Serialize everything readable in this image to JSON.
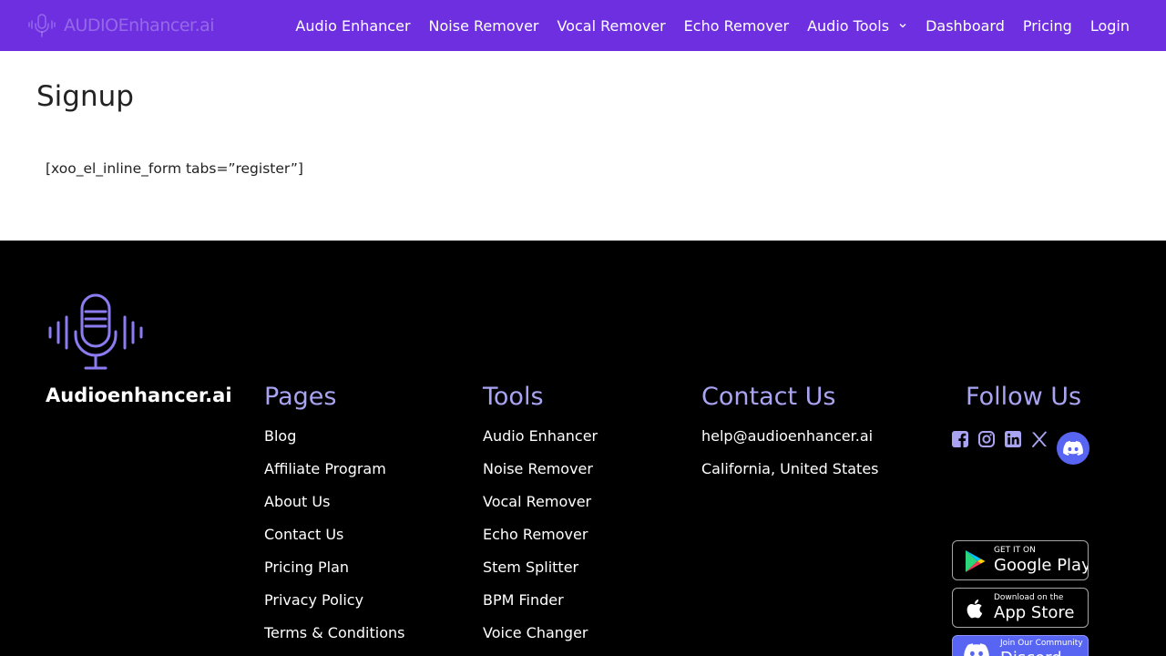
{
  "header": {
    "logo_text": "AUDIOEnhancer.ai",
    "nav": [
      {
        "label": "Audio Enhancer"
      },
      {
        "label": "Noise Remover"
      },
      {
        "label": "Vocal Remover"
      },
      {
        "label": "Echo Remover"
      },
      {
        "label": "Audio Tools",
        "icon": "chevron-down-icon"
      },
      {
        "label": "Dashboard"
      },
      {
        "label": "Pricing"
      },
      {
        "label": "Login"
      }
    ]
  },
  "main": {
    "title": "Signup",
    "shortcode": "[xoo_el_inline_form tabs=”register”]"
  },
  "footer": {
    "brand": "Audioenhancer.ai",
    "pages": {
      "title": "Pages",
      "links": [
        "Blog",
        "Affiliate Program",
        "About Us",
        "Contact Us",
        "Pricing Plan",
        "Privacy Policy",
        "Terms & Conditions"
      ]
    },
    "tools": {
      "title": "Tools",
      "links": [
        "Audio Enhancer",
        "Noise Remover",
        "Vocal Remover",
        "Echo Remover",
        "Stem Splitter",
        "BPM Finder",
        "Voice Changer"
      ]
    },
    "contact": {
      "title": "Contact Us",
      "email": "help@audioenhancer.ai",
      "location": "California, United States"
    },
    "follow": {
      "title": "Follow Us",
      "icons": [
        "facebook-icon",
        "instagram-icon",
        "linkedin-icon",
        "x-icon",
        "discord-icon"
      ]
    },
    "badges": {
      "google_play": {
        "small": "GET IT ON",
        "big": "Google Play"
      },
      "app_store": {
        "small": "Download on the",
        "big": "App Store"
      },
      "discord": {
        "small": "Join Our Community",
        "big": "Discord"
      }
    }
  },
  "colors": {
    "brand": "#6d2fe0",
    "accent": "#a9a4f2",
    "footer_bg": "#000000",
    "discord": "#5865f2"
  }
}
